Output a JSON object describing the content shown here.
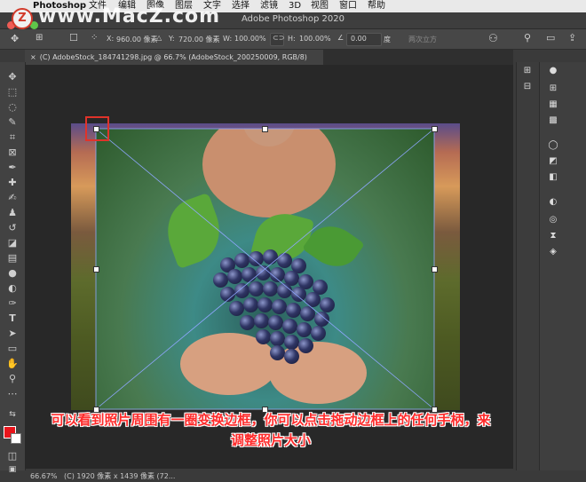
{
  "menubar": {
    "apple": "",
    "app_name": "Photoshop",
    "items": [
      "文件",
      "编辑",
      "图像",
      "图层",
      "文字",
      "选择",
      "滤镜",
      "3D",
      "视图",
      "窗口",
      "帮助"
    ]
  },
  "window": {
    "title": "Adobe Photoshop 2020"
  },
  "watermark": {
    "text": "www.MacZ.com",
    "logo": "Z"
  },
  "options": {
    "x_label": "X:",
    "x_value": "960.00 像素",
    "y_label": "Y:",
    "y_value": "720.00 像素",
    "w_label": "W:",
    "w_value": "100.00%",
    "h_label": "H:",
    "h_value": "100.00%",
    "angle_value": "0.00",
    "angle_unit": "度",
    "interpolation": "两次立方"
  },
  "tab": {
    "label": "(C) AdobeStock_184741298.jpg @ 66.7% (AdobeStock_200250009, RGB/8)"
  },
  "caption": {
    "line1": "可以看到照片周围有一圈变换边框，你可以点击拖动边框上的任何手柄，来",
    "line2": "调整照片大小"
  },
  "status": {
    "zoom": "66.67%",
    "doc_info": "(C) 1920 像素 x 1439 像素 (72..."
  },
  "colors": {
    "accent_red": "#e0332a",
    "caption_red": "#ff2a2a",
    "foreground": "#e8141b",
    "background": "#ffffff"
  },
  "icons": {
    "tools": [
      "move-icon",
      "marquee-icon",
      "lasso-icon",
      "quick-select-icon",
      "crop-icon",
      "frame-icon",
      "eyedropper-icon",
      "healing-icon",
      "brush-icon",
      "stamp-icon",
      "history-brush-icon",
      "eraser-icon",
      "gradient-icon",
      "blur-icon",
      "dodge-icon",
      "pen-icon",
      "type-icon",
      "path-select-icon",
      "rectangle-icon",
      "hand-icon",
      "zoom-icon",
      "more-icon"
    ],
    "panels": [
      "color-icon",
      "swatches-icon",
      "gradients-icon",
      "patterns-icon",
      "lightbulb-icon",
      "adjustments-icon",
      "properties-icon",
      "styles-icon",
      "channels-icon",
      "paths-icon",
      "layers-icon"
    ]
  }
}
